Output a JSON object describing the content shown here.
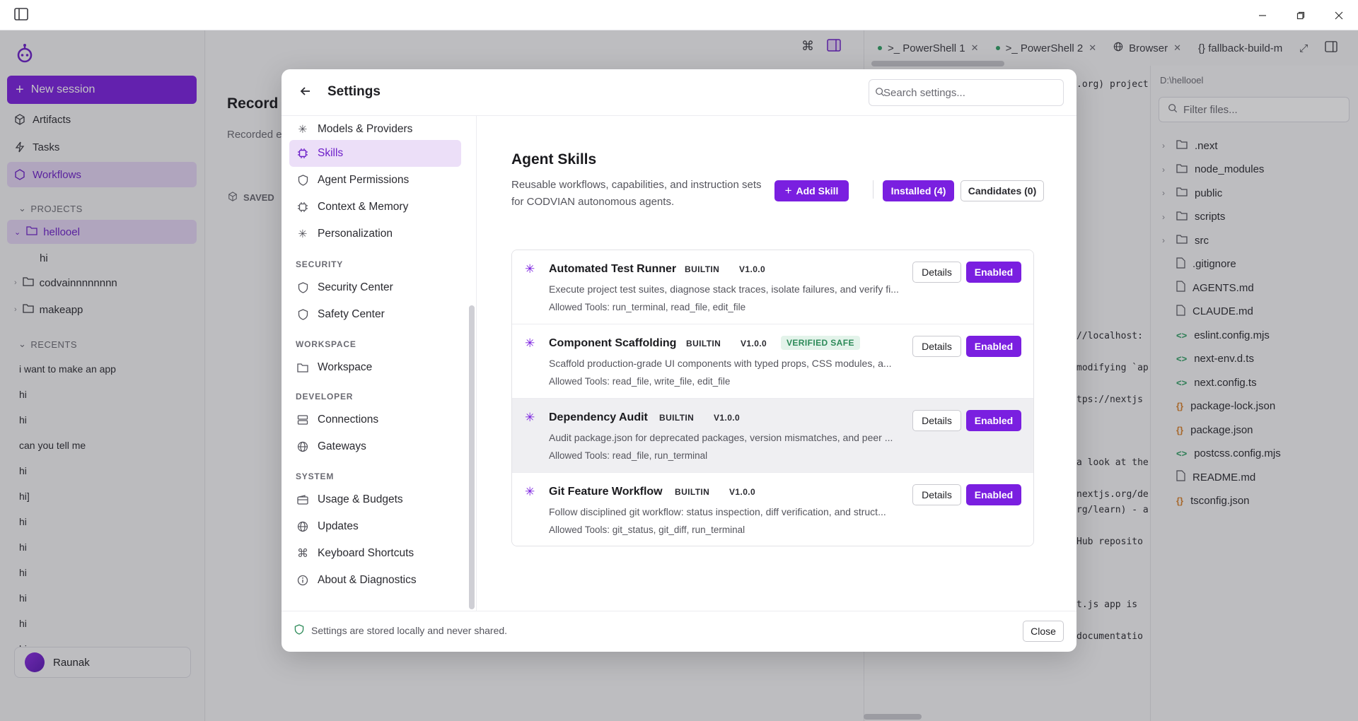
{
  "sidebar": {
    "new_session": "New session",
    "nav": [
      {
        "label": "Artifacts",
        "icon": "cube-icon"
      },
      {
        "label": "Tasks",
        "icon": "bolt-icon"
      },
      {
        "label": "Workflows",
        "icon": "hexagon-icon"
      }
    ],
    "projects_label": "PROJECTS",
    "projects": [
      {
        "label": "hellooel"
      },
      {
        "label": "hi"
      },
      {
        "label": "codvainnnnnnnn"
      },
      {
        "label": "makeapp"
      }
    ],
    "recents_label": "RECENTS",
    "recents": [
      "i want to make an app",
      "hi",
      "hi",
      "can you tell me",
      "hi",
      "hi]",
      "hi",
      "hi",
      "hi",
      "hi",
      "hi",
      "hi"
    ],
    "user_name": "Raunak"
  },
  "main": {
    "title": "Record",
    "subtitle": "Recorded e",
    "saved_label": "SAVED"
  },
  "terminal": {
    "tabs": [
      {
        "label": ">_ PowerShell 1"
      },
      {
        "label": ">_ PowerShell 2"
      },
      {
        "label": "Browser"
      },
      {
        "label": "{} fallback-build-m"
      }
    ],
    "lines": [
      {
        "text": ".org) project"
      },
      {
        "text": "//localhost:"
      },
      {
        "text": "modifying `ap"
      },
      {
        "text": "tps://nextjs"
      },
      {
        "text": "a look at the"
      },
      {
        "text": "nextjs.org/de"
      },
      {
        "text": "rg/learn) - a"
      },
      {
        "text": "Hub reposito"
      },
      {
        "text": "t.js app is"
      },
      {
        "text": "documentatio"
      }
    ]
  },
  "explorer": {
    "path": "D:\\hellooel",
    "filter_placeholder": "Filter files...",
    "files": [
      {
        "name": ".next",
        "kind": "folder"
      },
      {
        "name": "node_modules",
        "kind": "folder"
      },
      {
        "name": "public",
        "kind": "folder"
      },
      {
        "name": "scripts",
        "kind": "folder"
      },
      {
        "name": "src",
        "kind": "folder"
      },
      {
        "name": ".gitignore",
        "kind": "file"
      },
      {
        "name": "AGENTS.md",
        "kind": "file"
      },
      {
        "name": "CLAUDE.md",
        "kind": "file"
      },
      {
        "name": "eslint.config.mjs",
        "kind": "code"
      },
      {
        "name": "next-env.d.ts",
        "kind": "code"
      },
      {
        "name": "next.config.ts",
        "kind": "code"
      },
      {
        "name": "package-lock.json",
        "kind": "json"
      },
      {
        "name": "package.json",
        "kind": "json"
      },
      {
        "name": "postcss.config.mjs",
        "kind": "code"
      },
      {
        "name": "README.md",
        "kind": "file"
      },
      {
        "name": "tsconfig.json",
        "kind": "json"
      }
    ]
  },
  "settings": {
    "title": "Settings",
    "search_placeholder": "Search settings...",
    "menu": {
      "general": [
        {
          "label": "Models & Providers"
        },
        {
          "label": "Skills"
        },
        {
          "label": "Agent Permissions"
        },
        {
          "label": "Context & Memory"
        },
        {
          "label": "Personalization"
        }
      ],
      "security_label": "SECURITY",
      "security": [
        {
          "label": "Security Center"
        },
        {
          "label": "Safety Center"
        }
      ],
      "workspace_label": "WORKSPACE",
      "workspace": [
        {
          "label": "Workspace"
        }
      ],
      "developer_label": "DEVELOPER",
      "developer": [
        {
          "label": "Connections"
        },
        {
          "label": "Gateways"
        }
      ],
      "system_label": "SYSTEM",
      "system": [
        {
          "label": "Usage & Budgets"
        },
        {
          "label": "Updates"
        },
        {
          "label": "Keyboard Shortcuts"
        },
        {
          "label": "About & Diagnostics"
        }
      ]
    },
    "content": {
      "title": "Agent Skills",
      "description": "Reusable workflows, capabilities, and instruction sets for CODVIAN autonomous agents.",
      "add_skill": "Add Skill",
      "installed": "Installed (4)",
      "candidates": "Candidates (0)",
      "skills": [
        {
          "name": "Automated Test Runner",
          "source": "BUILTIN",
          "version": "V1.0.0",
          "verified": "",
          "description": "Execute project test suites, diagnose stack traces, isolate failures, and verify fi...",
          "tools": "Allowed Tools: run_terminal, read_file, edit_file",
          "details": "Details",
          "status": "Enabled"
        },
        {
          "name": "Component Scaffolding",
          "source": "BUILTIN",
          "version": "V1.0.0",
          "verified": "VERIFIED SAFE",
          "description": "Scaffold production-grade UI components with typed props, CSS modules, a...",
          "tools": "Allowed Tools: read_file, write_file, edit_file",
          "details": "Details",
          "status": "Enabled"
        },
        {
          "name": "Dependency Audit",
          "source": "BUILTIN",
          "version": "V1.0.0",
          "verified": "",
          "description": "Audit package.json for deprecated packages, version mismatches, and peer ...",
          "tools": "Allowed Tools: read_file, run_terminal",
          "details": "Details",
          "status": "Enabled"
        },
        {
          "name": "Git Feature Workflow",
          "source": "BUILTIN",
          "version": "V1.0.0",
          "verified": "",
          "description": "Follow disciplined git workflow: status inspection, diff verification, and struct...",
          "tools": "Allowed Tools: git_status, git_diff, run_terminal",
          "details": "Details",
          "status": "Enabled"
        }
      ]
    },
    "footer_note": "Settings are stored locally and never shared.",
    "close": "Close"
  },
  "colors": {
    "accent": "#7a1fe0",
    "accent_soft": "#ecdff8",
    "verified": "#2c8a58"
  }
}
